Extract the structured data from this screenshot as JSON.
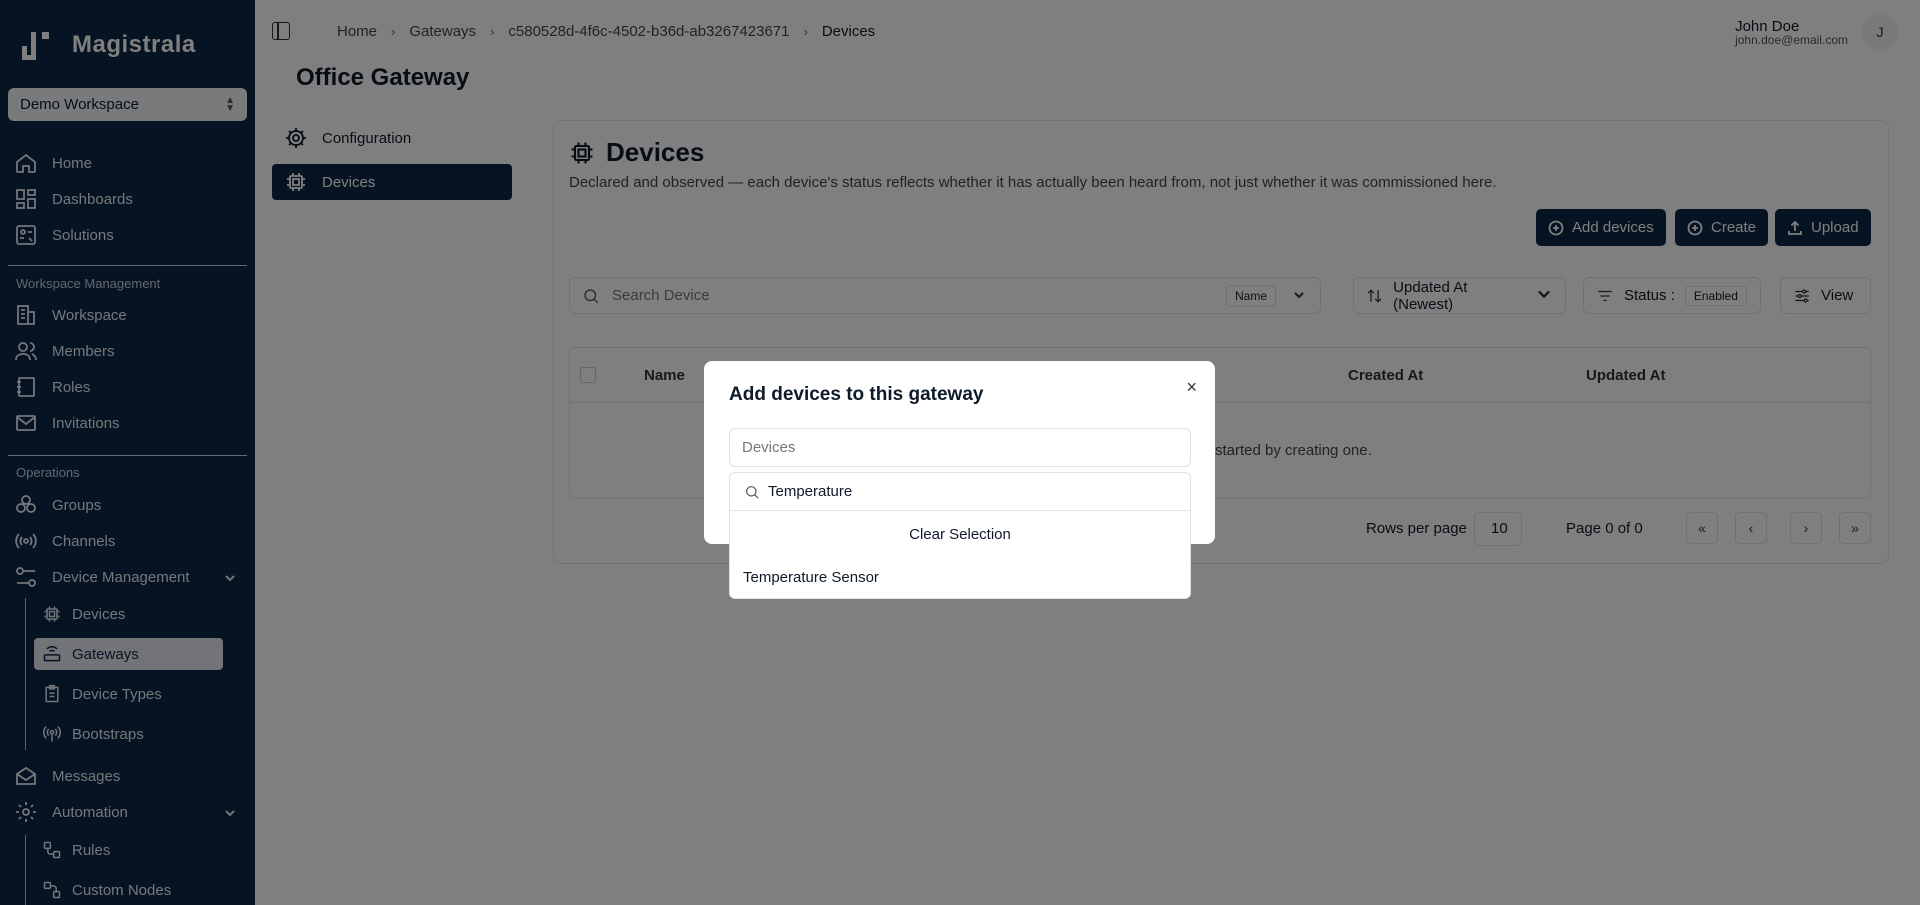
{
  "app": {
    "name": "Magistrala"
  },
  "workspace_select": {
    "value": "Demo Workspace"
  },
  "sidebar": {
    "main_items": [
      {
        "label": "Home"
      },
      {
        "label": "Dashboards"
      },
      {
        "label": "Solutions"
      }
    ],
    "workspace_section": "Workspace Management",
    "workspace_items": [
      {
        "label": "Workspace"
      },
      {
        "label": "Members"
      },
      {
        "label": "Roles"
      },
      {
        "label": "Invitations"
      }
    ],
    "operations_section": "Operations",
    "operations_items": [
      {
        "label": "Groups"
      },
      {
        "label": "Channels"
      },
      {
        "label": "Device Management"
      }
    ],
    "device_mgmt_sub": [
      {
        "label": "Devices"
      },
      {
        "label": "Gateways"
      },
      {
        "label": "Device Types"
      },
      {
        "label": "Bootstraps"
      }
    ],
    "bottom_items": [
      {
        "label": "Messages"
      },
      {
        "label": "Automation"
      }
    ],
    "automation_sub": [
      {
        "label": "Rules"
      },
      {
        "label": "Custom Nodes"
      }
    ]
  },
  "breadcrumb": {
    "items": [
      "Home",
      "Gateways",
      "c580528d-4f6c-4502-b36d-ab3267423671",
      "Devices"
    ],
    "separator": "›"
  },
  "user": {
    "name": "John Doe",
    "email": "john.doe@email.com",
    "initial": "J"
  },
  "page": {
    "title": "Office Gateway"
  },
  "tabs": [
    {
      "label": "Configuration"
    },
    {
      "label": "Devices"
    }
  ],
  "card": {
    "title": "Devices",
    "description": "Declared and observed — each device's status reflects whether it has actually been heard from, not just whether it was commissioned here.",
    "buttons": {
      "add": "Add devices",
      "create": "Create",
      "upload": "Upload"
    }
  },
  "filters": {
    "search_placeholder": "Search Device",
    "search_field": "Name",
    "sort": "Updated At (Newest)",
    "status_label": "Status :",
    "status_value": "Enabled",
    "view": "View"
  },
  "table": {
    "columns": [
      "Name",
      "Created At",
      "Updated At"
    ],
    "empty_fragment": "started by creating one."
  },
  "pagination": {
    "rows_label": "Rows per page",
    "rows_value": "10",
    "page_text": "Page 0 of 0",
    "first": "«",
    "prev": "‹",
    "next": "›",
    "last": "»"
  },
  "modal": {
    "title": "Add devices to this gateway",
    "close": "×",
    "field_placeholder": "Devices"
  },
  "dropdown": {
    "search_value": "Temperature",
    "clear": "Clear Selection",
    "options": [
      "Temperature Sensor"
    ]
  },
  "colors": {
    "sidebar_bg": "#0d2744",
    "primary": "#0d2744",
    "overlay": "rgba(0,0,0,0.5)"
  }
}
